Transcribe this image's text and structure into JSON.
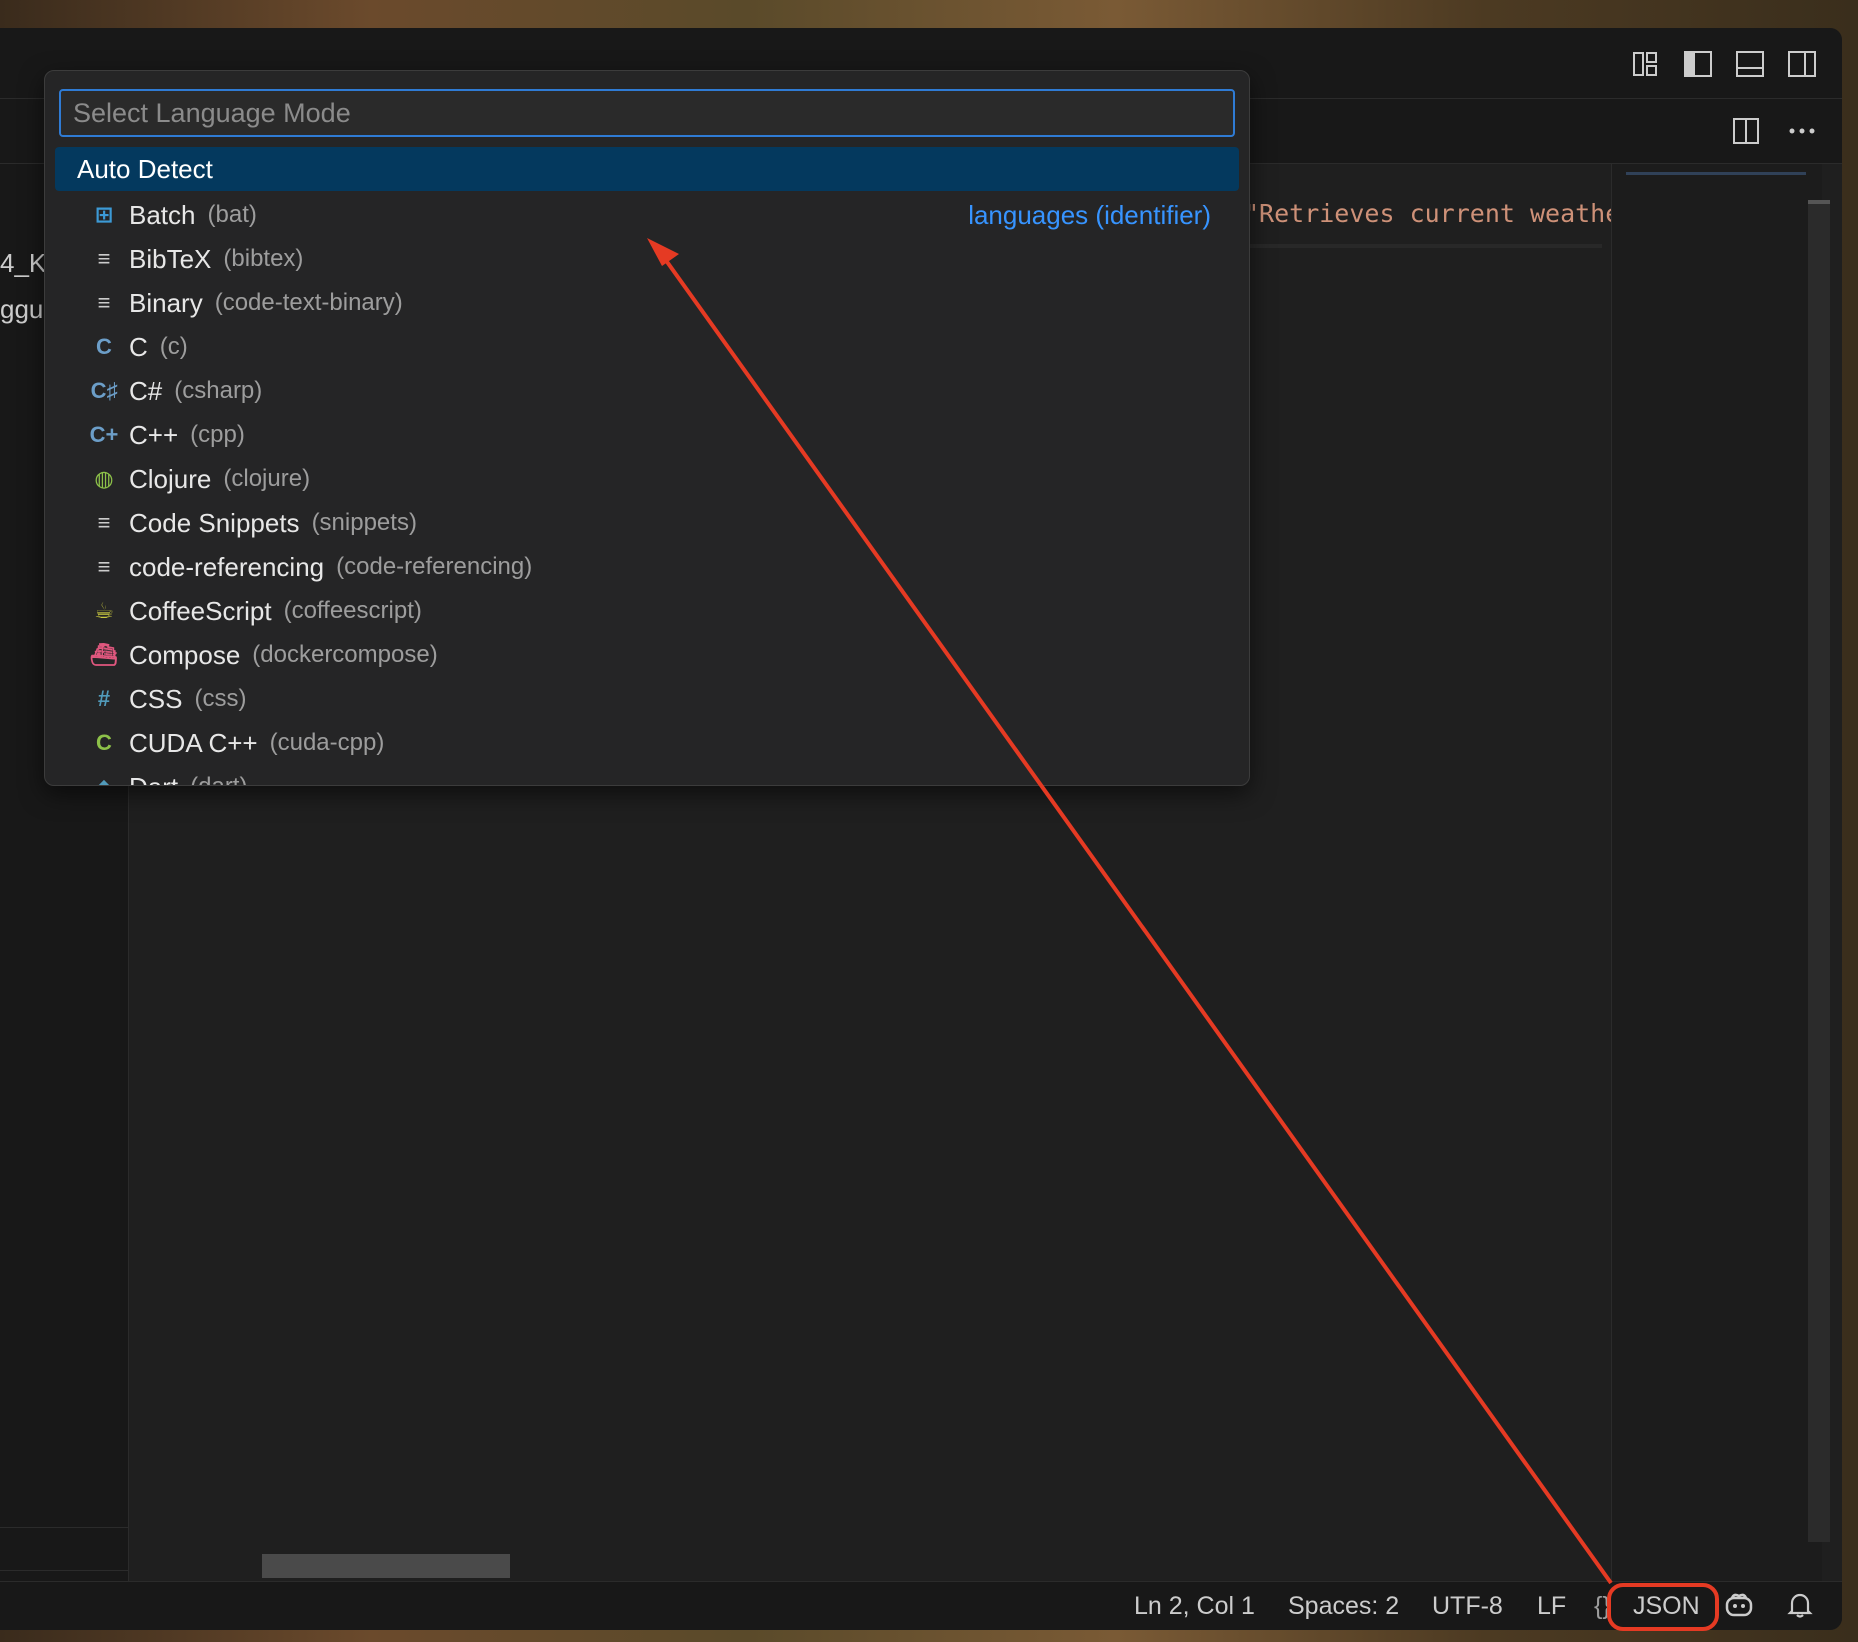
{
  "window": {
    "layout_icons": [
      "customize-layout-icon",
      "toggle-primary-sidebar-icon",
      "toggle-panel-icon",
      "toggle-secondary-sidebar-icon"
    ],
    "tab_actions": [
      "split-editor-icon",
      "more-actions-icon"
    ]
  },
  "sidebar": {
    "partial_texts": [
      "4_K",
      "ggu"
    ]
  },
  "editor": {
    "code_fragment": "\"Retrieves current weathe"
  },
  "quick_pick": {
    "placeholder": "Select Language Mode",
    "separator_label": "languages (identifier)",
    "items": [
      {
        "label": "Auto Detect",
        "id": "",
        "icon": "none",
        "active": true
      },
      {
        "label": "Batch",
        "id": "(bat)",
        "icon": "windows-icon",
        "color": "#3c9ad6",
        "glyph": "⊞"
      },
      {
        "label": "BibTeX",
        "id": "(bibtex)",
        "icon": "lines-icon",
        "color": "#cccccc",
        "glyph": "≡"
      },
      {
        "label": "Binary",
        "id": "(code-text-binary)",
        "icon": "lines-icon",
        "color": "#cccccc",
        "glyph": "≡"
      },
      {
        "label": "C",
        "id": "(c)",
        "icon": "c-icon",
        "color": "#6c9ec8",
        "glyph": "C"
      },
      {
        "label": "C#",
        "id": "(csharp)",
        "icon": "csharp-icon",
        "color": "#6c9ec8",
        "glyph": "C♯"
      },
      {
        "label": "C++",
        "id": "(cpp)",
        "icon": "cpp-icon",
        "color": "#6c9ec8",
        "glyph": "C+"
      },
      {
        "label": "Clojure",
        "id": "(clojure)",
        "icon": "clojure-icon",
        "color": "#8dc149",
        "glyph": "◍"
      },
      {
        "label": "Code Snippets",
        "id": "(snippets)",
        "icon": "lines-icon",
        "color": "#cccccc",
        "glyph": "≡"
      },
      {
        "label": "code-referencing",
        "id": "(code-referencing)",
        "icon": "lines-icon",
        "color": "#cccccc",
        "glyph": "≡"
      },
      {
        "label": "CoffeeScript",
        "id": "(coffeescript)",
        "icon": "coffee-icon",
        "color": "#cbcb41",
        "glyph": "☕"
      },
      {
        "label": "Compose",
        "id": "(dockercompose)",
        "icon": "docker-icon",
        "color": "#e0577e",
        "glyph": "⛴"
      },
      {
        "label": "CSS",
        "id": "(css)",
        "icon": "hash-icon",
        "color": "#519aba",
        "glyph": "#"
      },
      {
        "label": "CUDA C++",
        "id": "(cuda-cpp)",
        "icon": "cuda-icon",
        "color": "#8dc149",
        "glyph": "C"
      },
      {
        "label": "Dart",
        "id": "(dart)",
        "icon": "dart-icon",
        "color": "#519aba",
        "glyph": "◆"
      }
    ]
  },
  "statusbar": {
    "position": "Ln 2, Col 1",
    "spaces": "Spaces: 2",
    "encoding": "UTF-8",
    "eol": "LF",
    "language_braces": "{}",
    "language": "JSON",
    "copilot_icon": "copilot-icon",
    "bell_icon": "bell-icon"
  },
  "colors": {
    "accent": "#2f7bd4",
    "selection": "#04395e",
    "annotation": "#e53a23"
  }
}
